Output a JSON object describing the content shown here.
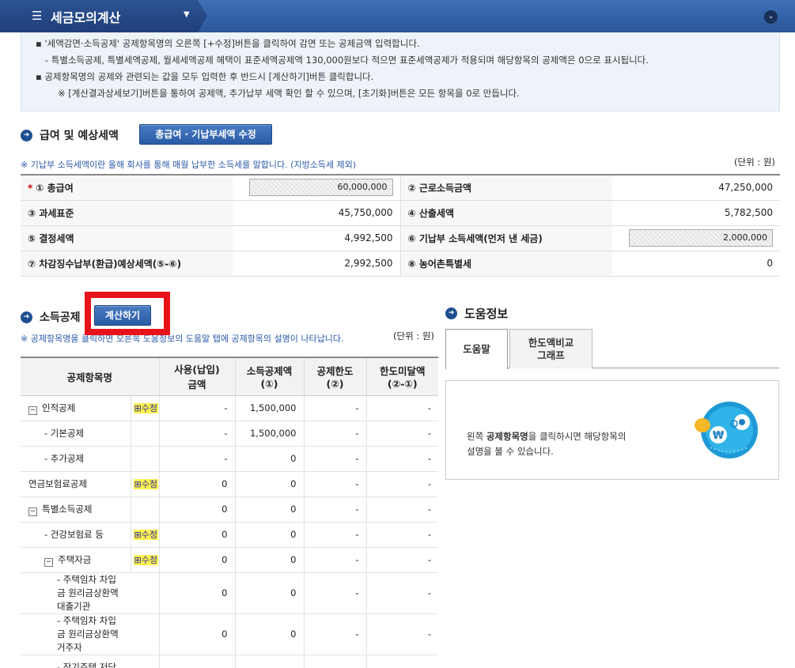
{
  "header": {
    "title": "세금모의계산",
    "menu_icon": "hamburger-icon",
    "dropdown_icon": "caret-down-icon",
    "collapse_icon": "chevron-down-circle-icon"
  },
  "notice": {
    "line1": "▪ '세액감면·소득공제' 공제항목명의 오른쪽 [+수정]버튼을 클릭하여 감면 또는 공제금액 입력합니다.",
    "line2": "- 특별소득공제, 특별세액공제, 월세세액공제 혜택이 표준세액공제액 130,000원보다 적으면 표준세액공제가 적용되며 해당항목의 공제액은 0으로 표시됩니다.",
    "line3": "▪ 공제항목명의 공제와 관련되는 값을 모두 입력한 후 반드시 [계산하기]버튼 클릭합니다.",
    "line4": "※ [계산결과상세보기]버튼을 통하여 공제액, 추가납부 세액 확인 할 수 있으며, [초기화]버튼은 모든 항목을 0로 만듭니다."
  },
  "salary": {
    "title": "급여 및 예상세액",
    "edit_button": "총급여 · 기납부세액 수정",
    "note": "※ 기납부 소득세액이란 올해 회사를 통해 매월 납부한 소득세를 말합니다. (지방소득세 제외)",
    "unit": "(단위 : 원)",
    "rows": [
      {
        "l1": "① 총급여",
        "v1": "60,000,000",
        "l2": "② 근로소득금액",
        "v2": "47,250,000"
      },
      {
        "l1": "③ 과세표준",
        "v1": "45,750,000",
        "l2": "④ 산출세액",
        "v2": "5,782,500"
      },
      {
        "l1": "⑤ 결정세액",
        "v1": "4,992,500",
        "l2": "⑥ 기납부 소득세액(먼저 낸 세금)",
        "v2": "2,000,000"
      },
      {
        "l1": "⑦ 차감징수납부(환급)예상세액(⑤-⑥)",
        "v1": "2,992,500",
        "l2": "⑧ 농어촌특별세",
        "v2": "0"
      }
    ]
  },
  "deduction": {
    "title": "소득공제",
    "calc_button": "계산하기",
    "note": "※ 공제항목명을 클릭하면 오른쪽 도움정보의 도움말 탭에 공제항목의 설명이 나타납니다.",
    "unit": "(단위 : 원)",
    "headers": [
      "공제항목명",
      "사용(납입)\n금액",
      "소득공제액\n(①)",
      "공제한도\n(②)",
      "한도미달액\n(②-①)"
    ],
    "edit_label": "⊞수정",
    "rows": [
      {
        "name": "인적공제",
        "box": "−",
        "edit": true,
        "c1": "-",
        "c2": "1,500,000",
        "c3": "-",
        "c4": "-"
      },
      {
        "name": "- 기본공제",
        "c1": "-",
        "c2": "1,500,000",
        "c3": "-",
        "c4": "-"
      },
      {
        "name": "- 추가공제",
        "c1": "-",
        "c2": "0",
        "c3": "-",
        "c4": "-"
      },
      {
        "name": "연금보험료공제",
        "edit": true,
        "c1": "0",
        "c2": "0",
        "c3": "-",
        "c4": "-"
      },
      {
        "name": "특별소득공제",
        "box": "−",
        "c1": "0",
        "c2": "0",
        "c3": "-",
        "c4": "-"
      },
      {
        "name": "- 건강보험료 등",
        "edit": true,
        "c1": "0",
        "c2": "0",
        "c3": "-",
        "c4": "-"
      },
      {
        "name": "주택자금",
        "box": "−",
        "edit": true,
        "c1": "0",
        "c2": "0",
        "c3": "-",
        "c4": "-"
      },
      {
        "name": "- 주택임차 차입금 원리금상환액 대출기관",
        "c1": "0",
        "c2": "0",
        "c3": "-",
        "c4": "-"
      },
      {
        "name": "- 주택임차 차입금 원리금상환액 거주자",
        "c1": "0",
        "c2": "0",
        "c3": "-",
        "c4": "-"
      },
      {
        "name": "- 장기주택 저당",
        "c1": "",
        "c2": "",
        "c3": "",
        "c4": ""
      }
    ]
  },
  "help": {
    "title": "도움정보",
    "tabs": [
      "도움말",
      "한도액비교\n그래프"
    ],
    "text_a": "왼쪽 ",
    "text_b": "공제항목명",
    "text_c": "을 클릭하시면 해당항목의",
    "text_d": "설명을 볼 수 있습니다."
  }
}
